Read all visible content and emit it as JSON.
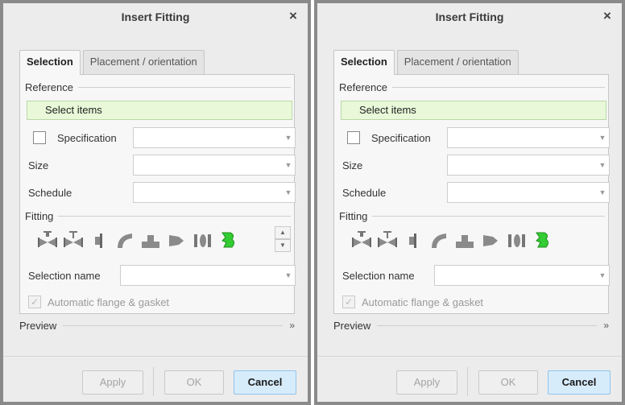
{
  "dialogs": [
    {
      "title": "Insert Fitting",
      "close_icon": "×",
      "tabs": [
        "Selection",
        "Placement / orientation"
      ],
      "reference_label": "Reference",
      "select_items": "Select items",
      "specification_label": "Specification",
      "size_label": "Size",
      "schedule_label": "Schedule",
      "fitting_label": "Fitting",
      "selection_name_label": "Selection name",
      "auto_flange_label": "Automatic flange & gasket",
      "preview_label": "Preview",
      "buttons": {
        "apply": "Apply",
        "ok": "OK",
        "cancel": "Cancel"
      }
    },
    {
      "title": "Insert Fitting",
      "close_icon": "×",
      "tabs": [
        "Selection",
        "Placement / orientation"
      ],
      "reference_label": "Reference",
      "select_items": "Select items",
      "specification_label": "Specification",
      "size_label": "Size",
      "schedule_label": "Schedule",
      "fitting_label": "Fitting",
      "selection_name_label": "Selection name",
      "auto_flange_label": "Automatic flange & gasket",
      "preview_label": "Preview",
      "buttons": {
        "apply": "Apply",
        "ok": "OK",
        "cancel": "Cancel"
      }
    }
  ],
  "colors": {
    "reference_bg": "#e8f8d8",
    "cancel_bg": "#d7ecfb",
    "fitting_highlight": "#33cc33"
  },
  "icons": {
    "fitting_icons": [
      "valve-icon",
      "gate-valve-icon",
      "flange-icon",
      "elbow-icon",
      "tee-icon",
      "reducer-icon",
      "coupling-icon",
      "custom-fitting-icon"
    ],
    "preview_expand": "double-chevron-down-icon"
  }
}
